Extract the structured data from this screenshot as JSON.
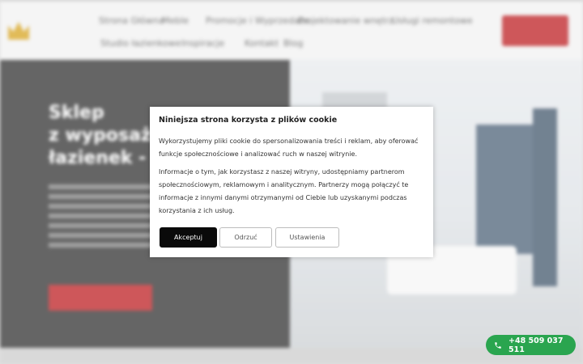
{
  "header": {
    "nav_items": [
      {
        "label": "Strona Główna"
      },
      {
        "label": "Meble"
      },
      {
        "label": "Promocje i Wyprzedaże"
      },
      {
        "label": "Projektowanie wnętrz"
      },
      {
        "label": "Usługi remontowe"
      },
      {
        "label": "Studio łazienkowe"
      },
      {
        "label": "Inspiracje"
      },
      {
        "label": "Kontakt"
      },
      {
        "label": "Blog"
      }
    ],
    "cta_label": ""
  },
  "hero": {
    "title_lines": [
      "Sklep",
      "z wyposażeniem",
      "łazienek -"
    ],
    "button_label": ""
  },
  "cookie_modal": {
    "title": "Niniejsza strona korzysta z plików cookie",
    "paragraph_1": "Wykorzystujemy pliki cookie do spersonalizowania treści i reklam, aby oferować funkcje społecznościowe i analizować ruch w naszej witrynie.",
    "paragraph_2": "Informacje o tym, jak korzystasz z naszej witryny, udostępniamy partnerom społecznościowym, reklamowym i analitycznym. Partnerzy mogą połączyć te informacje z innymi danymi otrzymanymi od Ciebie lub uzyskanymi podczas korzystania z ich usług.",
    "accept_label": "Akceptuj",
    "reject_label": "Odrzuć",
    "settings_label": "Ustawienia"
  },
  "phone_button": {
    "number": "+48 509 037 511",
    "icon": "phone-icon"
  },
  "colors": {
    "brand_red": "#c0282c",
    "accept_black": "#0a0a0a",
    "phone_green": "#2aa54f"
  }
}
